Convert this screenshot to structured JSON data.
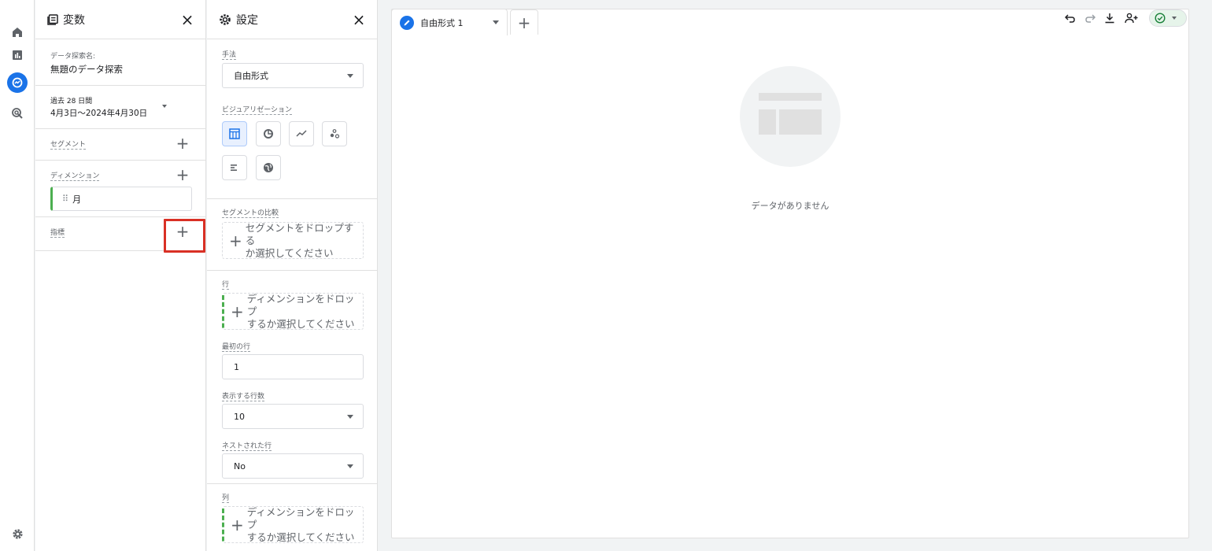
{
  "variables_panel": {
    "title": "変数",
    "close_icon": "×",
    "exploration_name_label": "データ探索名:",
    "exploration_name": "無題のデータ探索",
    "date_range_label": "過去 28 日間",
    "date_range_value": "4月3日～2024年4月30日",
    "segments_label": "セグメント",
    "dimensions_label": "ディメンション",
    "dimension_chip": "月",
    "metrics_label": "指標",
    "plus": "+"
  },
  "settings_panel": {
    "title": "設定",
    "close_icon": "×",
    "technique_label": "手法",
    "technique_value": "自由形式",
    "visualization_label": "ビジュアリゼーション",
    "segment_compare_label": "セグメントの比較",
    "segment_drop_line1": "セグメントをドロップする",
    "segment_drop_line2": "か選択してください",
    "rows_label": "行",
    "rows_drop_line1": "ディメンションをドロップ",
    "rows_drop_line2": "するか選択してください",
    "start_row_label": "最初の行",
    "start_row_value": "1",
    "show_rows_label": "表示する行数",
    "show_rows_value": "10",
    "nested_rows_label": "ネストされた行",
    "nested_rows_value": "No",
    "columns_label": "列",
    "columns_drop_line1": "ディメンションをドロップ",
    "columns_drop_line2": "するか選択してください",
    "plus": "+"
  },
  "canvas": {
    "tab_label": "自由形式 1",
    "add_tab": "+",
    "empty_text": "データがありません"
  },
  "colors": {
    "accent": "#1a73e8",
    "highlight_border": "#d93025",
    "chip_accent": "#4caf50",
    "status_green": "#188038"
  },
  "icons": [
    "home-icon",
    "reports-icon",
    "explore-icon",
    "advertising-icon",
    "settings-gear-icon",
    "undo-icon",
    "redo-icon",
    "download-icon",
    "share-user-icon",
    "check-circle-icon"
  ]
}
